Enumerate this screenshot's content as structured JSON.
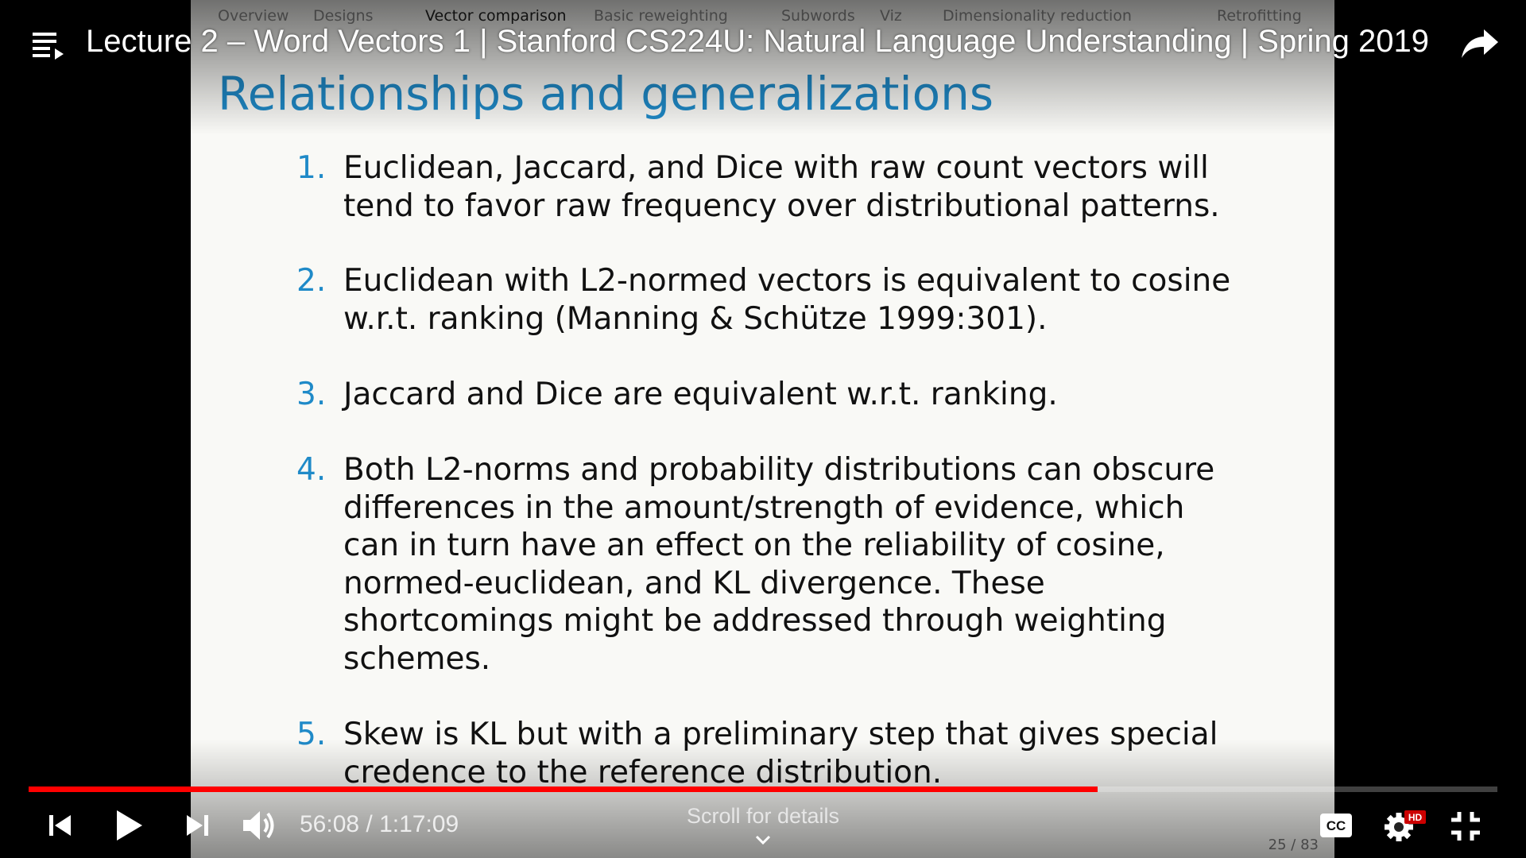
{
  "video": {
    "title": "Lecture 2 – Word Vectors 1 | Stanford CS224U: Natural Language Understanding | Spring 2019"
  },
  "slide": {
    "nav": [
      {
        "label": "Overview",
        "active": false
      },
      {
        "label": "Designs",
        "active": false
      },
      {
        "label": "Vector comparison",
        "active": true
      },
      {
        "label": "Basic reweighting",
        "active": false
      },
      {
        "label": "Subwords",
        "active": false
      },
      {
        "label": "Viz",
        "active": false
      },
      {
        "label": "Dimensionality reduction",
        "active": false
      },
      {
        "label": "Retrofitting",
        "active": false
      }
    ],
    "title": "Relationships and generalizations",
    "items": [
      {
        "num": "1.",
        "text": "Euclidean, Jaccard, and Dice with raw count vectors will tend to favor raw frequency over distributional patterns."
      },
      {
        "num": "2.",
        "text": "Euclidean with L2-normed vectors is equivalent to cosine w.r.t. ranking (Manning & Schütze 1999:301)."
      },
      {
        "num": "3.",
        "text": "Jaccard and Dice are equivalent w.r.t. ranking."
      },
      {
        "num": "4.",
        "text": "Both L2-norms and probability distributions can obscure differences in the amount/strength of evidence, which can in turn have an effect on the reliability of cosine, normed-euclidean, and KL divergence. These shortcomings might be addressed through weighting schemes."
      },
      {
        "num": "5.",
        "text": "Skew is KL but with a preliminary step that gives special credence to the reference distribution."
      }
    ],
    "page": "25 / 83"
  },
  "player": {
    "current_time": "56:08",
    "duration": "1:17:09",
    "time_text": "56:08 / 1:17:09",
    "progress_fraction": 0.7276,
    "buffer_fraction": 0.6,
    "scroll_hint": "Scroll for details",
    "settings_badge": "HD",
    "cc_label": "CC"
  },
  "icons": {
    "playlist": "playlist-icon",
    "share": "share-icon",
    "previous": "skip-previous-icon",
    "play": "play-icon",
    "next": "skip-next-icon",
    "volume": "volume-icon",
    "captions": "closed-captions-icon",
    "settings": "settings-gear-icon",
    "exit_fullscreen": "exit-fullscreen-icon",
    "scroll": "chevron-down-icon"
  },
  "colors": {
    "progress_played": "#ff0000",
    "slide_accent": "#1f8ac8",
    "hd_badge": "#cc0000"
  }
}
